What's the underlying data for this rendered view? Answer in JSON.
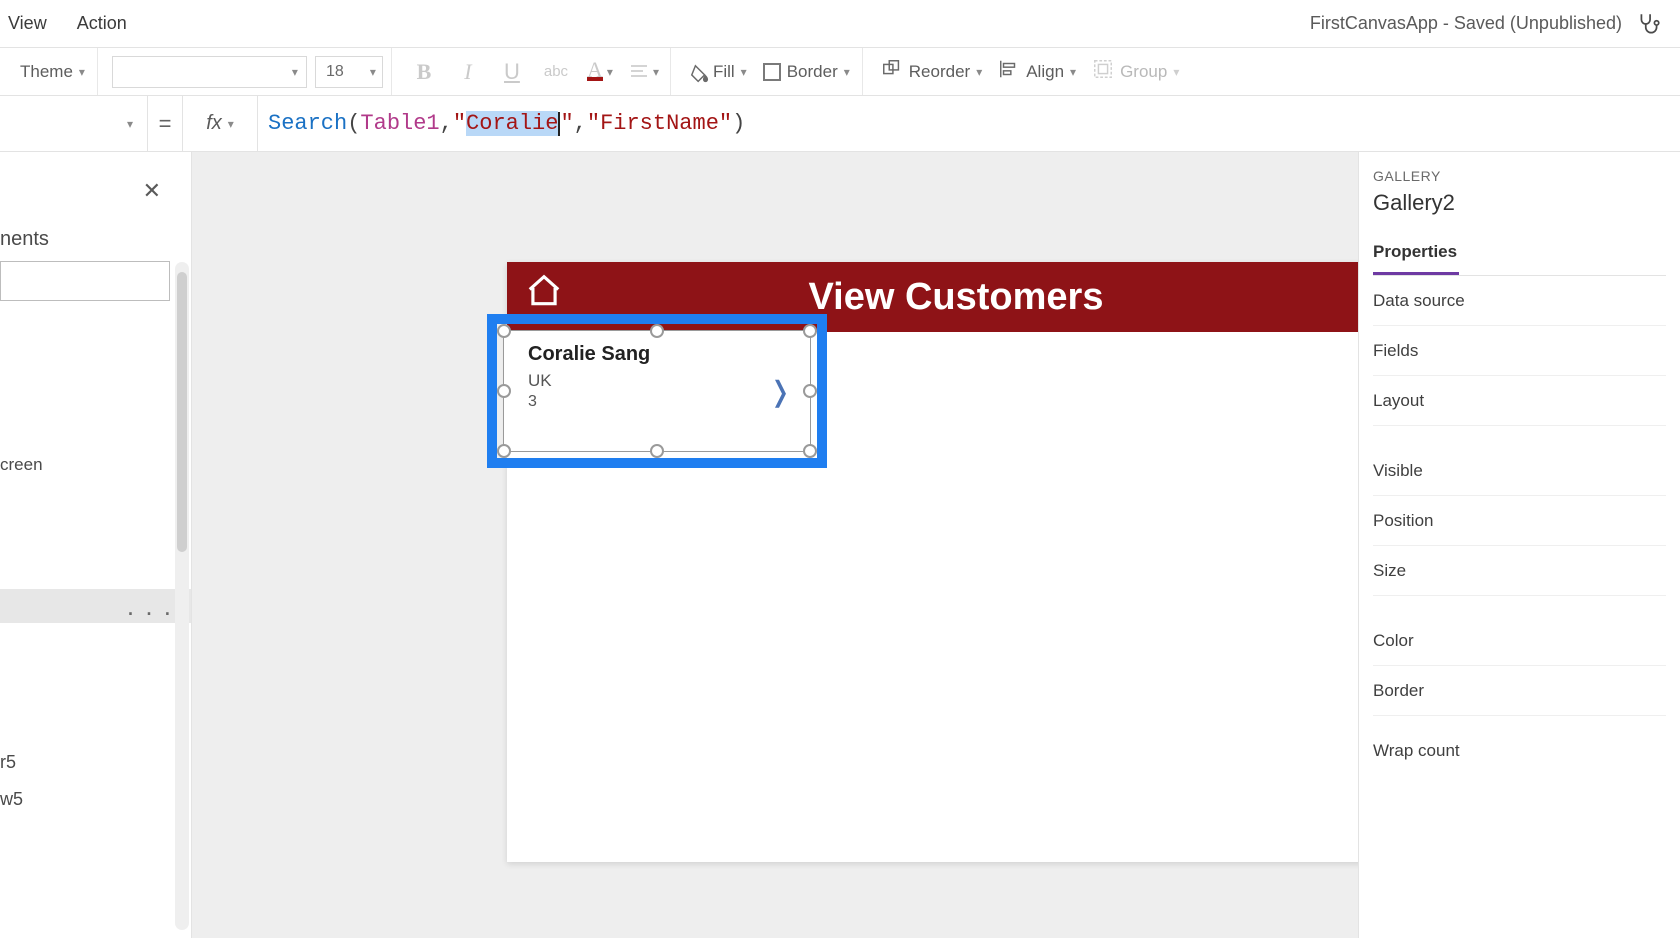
{
  "menu": {
    "view": "View",
    "action": "Action",
    "title": "FirstCanvasApp - Saved (Unpublished)"
  },
  "toolbar": {
    "theme_label": "Theme",
    "font_size": "18",
    "fill_label": "Fill",
    "border_label": "Border",
    "reorder_label": "Reorder",
    "align_label": "Align",
    "group_label": "Group"
  },
  "formula": {
    "equals": "=",
    "fx": "fx",
    "tokens": {
      "fn": "Search",
      "open": "(",
      "id": "Table1",
      "c1": ", ",
      "q1": "\"",
      "str_pre": "Cor",
      "str_mid": "a",
      "str_post": "lie",
      "q2": "\"",
      "c2": ", ",
      "q3": "\"",
      "col": "FirstName",
      "q4": "\"",
      "close": ")"
    }
  },
  "left_pane": {
    "heading": "nents",
    "tree": {
      "screen": "creen",
      "r5": "r5",
      "w5": "w5"
    },
    "more": ". . ."
  },
  "canvas": {
    "header_title": "View Customers",
    "item": {
      "title": "Coralie  Sang",
      "subtitle": "UK",
      "body": "3",
      "chevron": "❭"
    }
  },
  "right_pane": {
    "category": "GALLERY",
    "name": "Gallery2",
    "tab_properties": "Properties",
    "rows": {
      "data_source": "Data source",
      "fields": "Fields",
      "layout": "Layout",
      "visible": "Visible",
      "position": "Position",
      "size": "Size",
      "color": "Color",
      "border": "Border",
      "wrap_count": "Wrap count"
    }
  }
}
